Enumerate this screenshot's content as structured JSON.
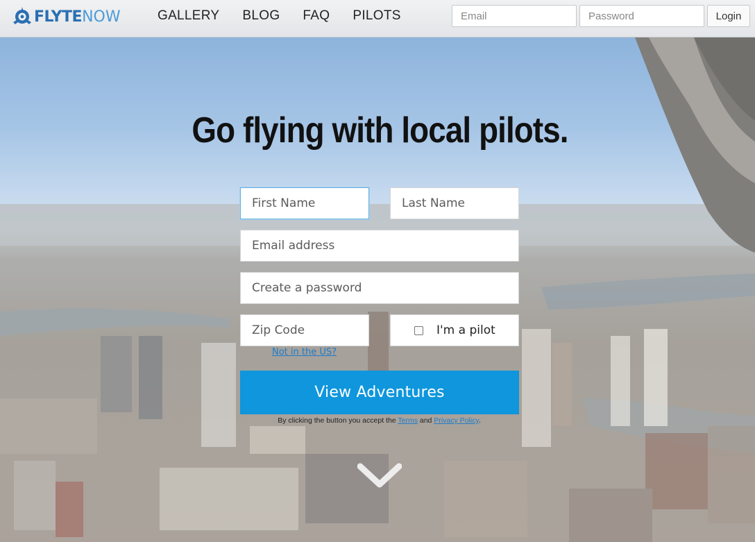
{
  "header": {
    "logo": {
      "part1": "FLYTE",
      "part2": "NOW",
      "icon": "propeller-logo-icon"
    },
    "nav": [
      "GALLERY",
      "BLOG",
      "FAQ",
      "PILOTS"
    ],
    "email_placeholder": "Email",
    "password_placeholder": "Password",
    "login_label": "Login"
  },
  "hero": {
    "headline": "Go flying with local pilots.",
    "first_name_placeholder": "First Name",
    "last_name_placeholder": "Last Name",
    "email_placeholder": "Email address",
    "password_placeholder": "Create a password",
    "zip_placeholder": "Zip Code",
    "pilot_label": "I'm a pilot",
    "not_us_link": "Not in the US?",
    "cta_label": "View Adventures",
    "terms": {
      "prefix": "By clicking the button you accept the ",
      "terms_link": "Terms",
      "middle": " and ",
      "privacy_link": "Privacy Policy",
      "suffix": "."
    },
    "scroll_icon": "chevron-down-icon"
  },
  "colors": {
    "accent": "#0f96dd",
    "link": "#1e7ac9",
    "logo_dark": "#2a6fb3",
    "logo_light": "#4d9bd8"
  }
}
